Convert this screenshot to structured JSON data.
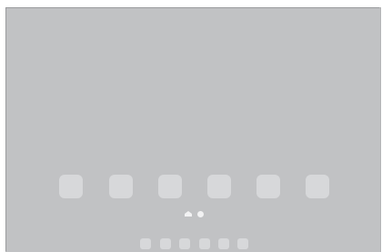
{
  "screen": {
    "background_color": "#c1c2c4",
    "app_icon_color": "#d7d8da",
    "indicator_color": "#f2f2f3"
  },
  "home_screen": {
    "app_icons": [
      {
        "icon": "app-icon"
      },
      {
        "icon": "app-icon"
      },
      {
        "icon": "app-icon"
      },
      {
        "icon": "app-icon"
      },
      {
        "icon": "app-icon"
      },
      {
        "icon": "app-icon"
      }
    ],
    "page_indicator": {
      "items": [
        "home-icon",
        "page-dot"
      ],
      "current_page": 1,
      "page_count": 2
    }
  },
  "dock": {
    "icons": [
      {
        "icon": "app-icon"
      },
      {
        "icon": "app-icon"
      },
      {
        "icon": "app-icon"
      },
      {
        "icon": "app-icon"
      },
      {
        "icon": "app-icon"
      },
      {
        "icon": "app-icon"
      }
    ]
  }
}
